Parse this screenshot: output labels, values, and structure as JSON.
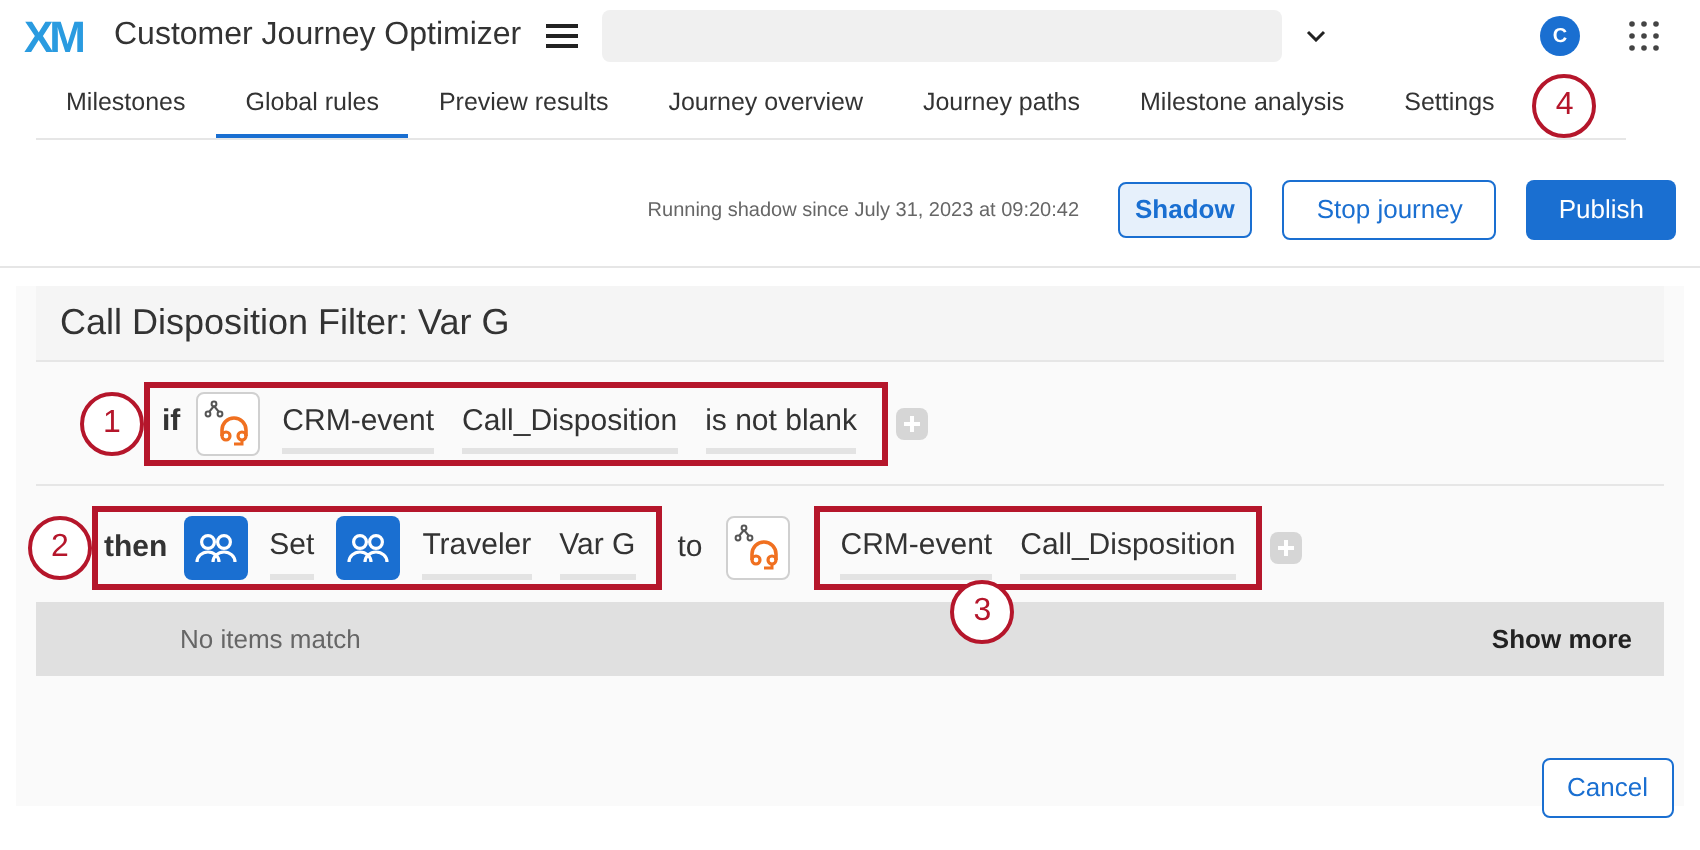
{
  "header": {
    "logo": "XM",
    "app_title": "Customer Journey Optimizer",
    "user_initial": "C"
  },
  "tabs": [
    {
      "label": "Milestones",
      "selected": false
    },
    {
      "label": "Global rules",
      "selected": true
    },
    {
      "label": "Preview results",
      "selected": false
    },
    {
      "label": "Journey overview",
      "selected": false
    },
    {
      "label": "Journey paths",
      "selected": false
    },
    {
      "label": "Milestone analysis",
      "selected": false
    },
    {
      "label": "Settings",
      "selected": false
    }
  ],
  "tabs_callout": "4",
  "status_text": "Running shadow since July 31, 2023 at 09:20:42",
  "actions": [
    {
      "label": "Shadow",
      "kind": "toggle"
    },
    {
      "label": "Stop journey",
      "kind": "outline"
    },
    {
      "label": "Publish",
      "kind": "primary"
    }
  ],
  "rule": {
    "title": "Call Disposition Filter: Var G",
    "condition": {
      "callout": "1",
      "keyword": "if",
      "parts": [
        {
          "kind": "event-icon"
        },
        {
          "kind": "token",
          "text": "CRM-event"
        },
        {
          "kind": "token",
          "text": "Call_Disposition"
        },
        {
          "kind": "token",
          "text": "is not blank"
        }
      ]
    },
    "action": {
      "callout": "2",
      "keyword": "then",
      "parts": [
        {
          "kind": "people-icon"
        },
        {
          "kind": "token",
          "text": "Set"
        },
        {
          "kind": "people-icon"
        },
        {
          "kind": "token",
          "text": "Traveler"
        },
        {
          "kind": "token",
          "text": "Var G"
        }
      ]
    },
    "connector": "to",
    "target": {
      "callout": "3",
      "parts": [
        {
          "kind": "token",
          "text": "CRM-event"
        },
        {
          "kind": "token",
          "text": "Call_Disposition"
        }
      ]
    },
    "dropdown": {
      "empty_text": "No items match",
      "more": "Show more"
    }
  },
  "footer_button": "Cancel"
}
